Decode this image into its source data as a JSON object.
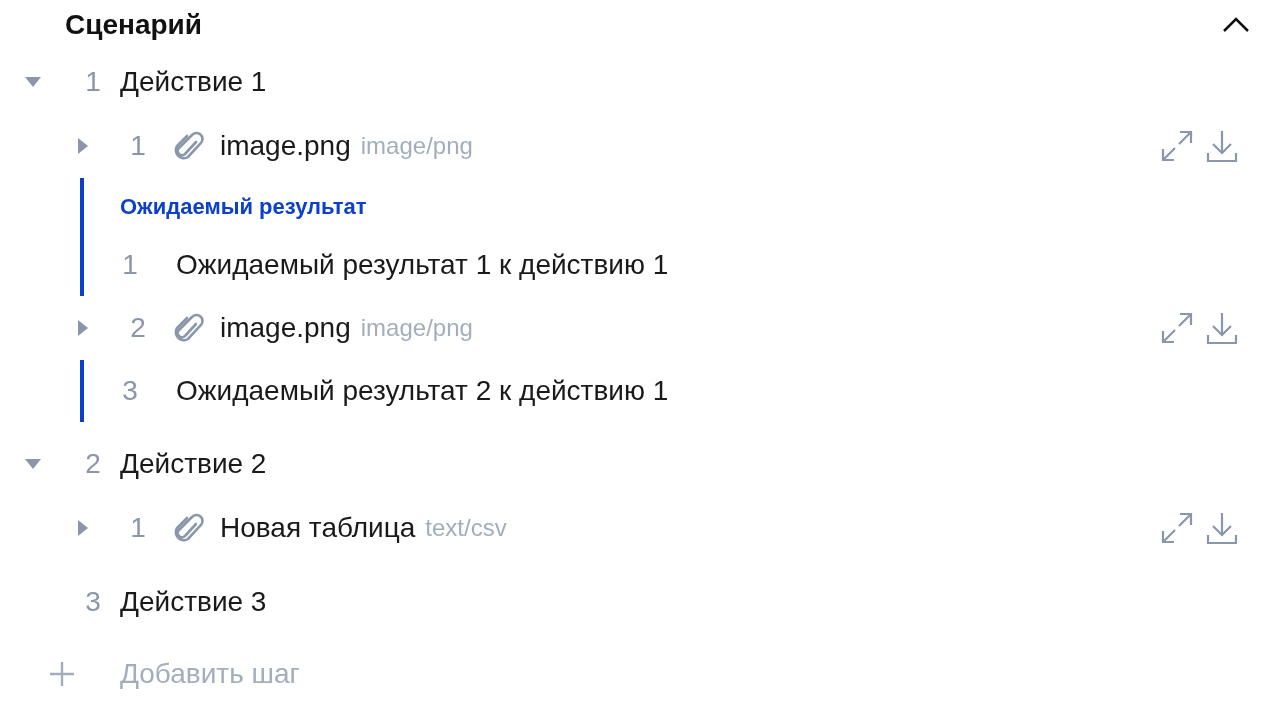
{
  "section": {
    "title": "Сценарий",
    "expanded": true
  },
  "steps": [
    {
      "number": "1",
      "label": "Действие 1",
      "expanded": true,
      "children": [
        {
          "kind": "attachment",
          "number": "1",
          "name": "image.png",
          "mime": "image/png",
          "expanded": false
        },
        {
          "kind": "expected",
          "heading": "Ожидаемый результат",
          "number": "1",
          "text": "Ожидаемый результат 1 к действию 1"
        },
        {
          "kind": "attachment",
          "number": "2",
          "name": "image.png",
          "mime": "image/png",
          "expanded": false
        },
        {
          "kind": "expected",
          "number": "3",
          "text": "Ожидаемый результат 2 к действию 1"
        }
      ]
    },
    {
      "number": "2",
      "label": "Действие 2",
      "expanded": true,
      "children": [
        {
          "kind": "attachment",
          "number": "1",
          "name": "Новая таблица",
          "mime": "text/csv",
          "expanded": false
        }
      ]
    },
    {
      "number": "3",
      "label": "Действие 3"
    }
  ],
  "add_step": "Добавить шаг"
}
